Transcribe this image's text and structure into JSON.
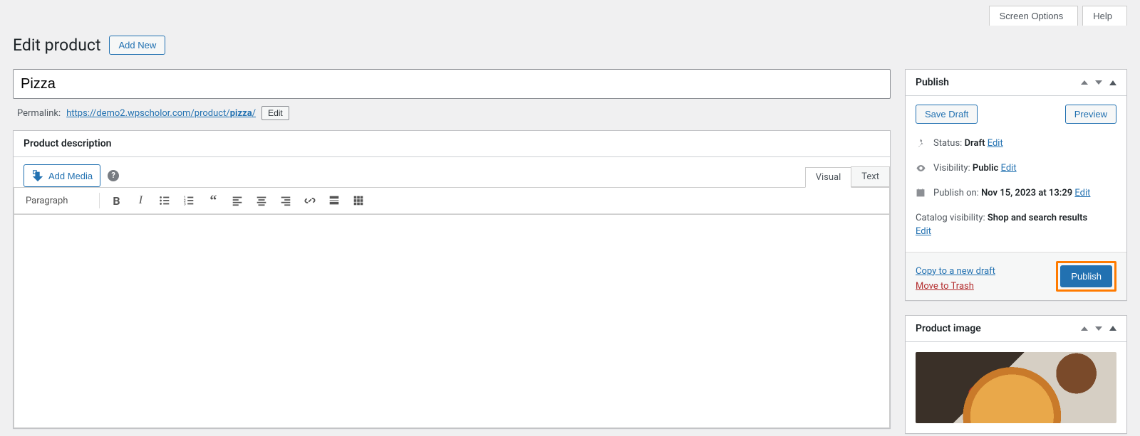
{
  "topbar": {
    "screen_options": "Screen Options",
    "help": "Help"
  },
  "header": {
    "title": "Edit product",
    "add_new": "Add New"
  },
  "title_input": {
    "value": "Pizza"
  },
  "permalink": {
    "label": "Permalink:",
    "url_base": "https://demo2.wpscholor.com/product/",
    "slug": "pizza",
    "trail": "/",
    "edit": "Edit"
  },
  "editor": {
    "box_title": "Product description",
    "add_media": "Add Media",
    "tab_visual": "Visual",
    "tab_text": "Text",
    "format_label": "Paragraph"
  },
  "publish": {
    "box_title": "Publish",
    "save_draft": "Save Draft",
    "preview": "Preview",
    "status_label": "Status:",
    "status_value": "Draft",
    "status_edit": "Edit",
    "visibility_label": "Visibility:",
    "visibility_value": "Public",
    "visibility_edit": "Edit",
    "schedule_label": "Publish on:",
    "schedule_value": "Nov 15, 2023 at 13:29",
    "schedule_edit": "Edit",
    "catalog_label": "Catalog visibility:",
    "catalog_value": "Shop and search results",
    "catalog_edit": "Edit",
    "copy_link": "Copy to a new draft",
    "trash_link": "Move to Trash",
    "publish_btn": "Publish"
  },
  "product_image": {
    "box_title": "Product image"
  }
}
